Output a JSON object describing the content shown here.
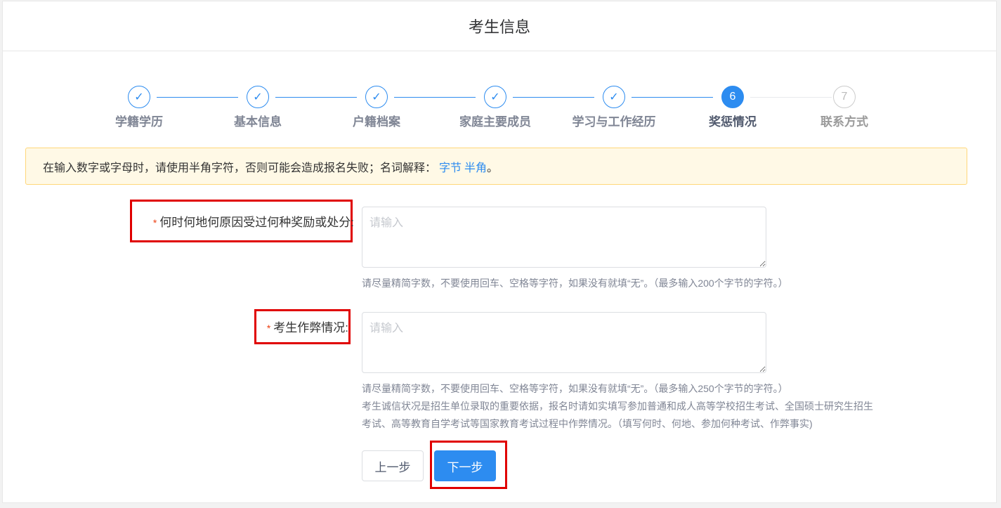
{
  "header": {
    "title": "考生信息"
  },
  "steps": [
    {
      "label": "学籍学历",
      "icon": "✓"
    },
    {
      "label": "基本信息",
      "icon": "✓"
    },
    {
      "label": "户籍档案",
      "icon": "✓"
    },
    {
      "label": "家庭主要成员",
      "icon": "✓"
    },
    {
      "label": "学习与工作经历",
      "icon": "✓"
    },
    {
      "label": "奖惩情况",
      "icon": "6"
    },
    {
      "label": "联系方式",
      "icon": "7"
    }
  ],
  "notice": {
    "text": "在输入数字或字母时，请使用半角字符，否则可能会造成报名失败；名词解释：",
    "link1": "字节",
    "link2": "半角",
    "suffix": "。"
  },
  "fields": {
    "rewards": {
      "required_mark": "*",
      "label": "何时何地何原因受过何种奖励或处分:",
      "placeholder": "请输入",
      "hint": "请尽量精简字数，不要使用回车、空格等字符，如果没有就填“无”。（最多输入200个字节的字符。）"
    },
    "cheating": {
      "required_mark": "*",
      "label": "考生作弊情况:",
      "placeholder": "请输入",
      "hint1": "请尽量精简字数，不要使用回车、空格等字符，如果没有就填“无”。（最多输入250个字节的字符。）",
      "hint2": "考生诚信状况是招生单位录取的重要依据，报名时请如实填写参加普通和成人高等学校招生考试、全国硕士研究生招生考试、高等教育自学考试等国家教育考试过程中作弊情况。（填写何时、何地、参加何种考试、作弊事实)"
    }
  },
  "buttons": {
    "prev": "上一步",
    "next": "下一步"
  },
  "colors": {
    "primary": "#2d8cf0",
    "highlight": "#e00000",
    "required": "#ed4014"
  }
}
